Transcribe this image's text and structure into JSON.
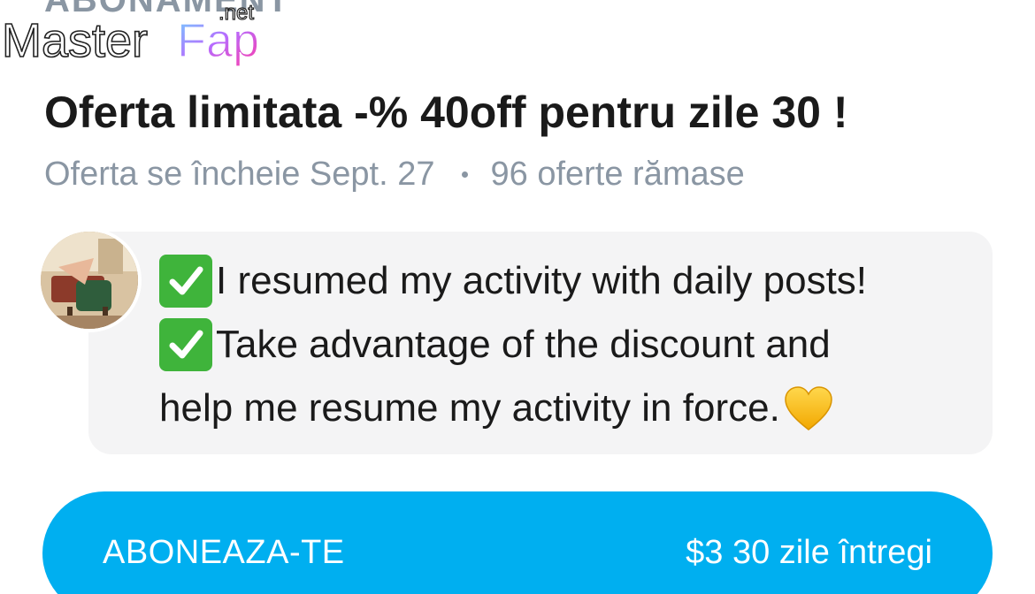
{
  "section": {
    "label": "ABONAMENT"
  },
  "watermark": {
    "text_main": "MasterFap",
    "text_tld": ".net"
  },
  "offer": {
    "title": "Oferta limitata -% 40off pentru zile 30 !",
    "ends": "Oferta se încheie Sept. 27",
    "remaining": "96 oferte rămase"
  },
  "message": {
    "line1": "I resumed my activity with daily posts!",
    "line2": "Take advantage of the discount and",
    "line3": "help me resume my activity in force.",
    "icons": [
      "check-mark-icon",
      "check-mark-icon",
      "yellow-heart-icon"
    ]
  },
  "subscribe": {
    "label": "ABONEAZA-TE",
    "price": "$3 30 zile întregi"
  },
  "colors": {
    "accent": "#00aff0",
    "muted_text": "#8a96a3",
    "bubble_bg": "#f4f4f5",
    "check_green": "#3fb43b",
    "heart_yellow": "#f5c518"
  }
}
